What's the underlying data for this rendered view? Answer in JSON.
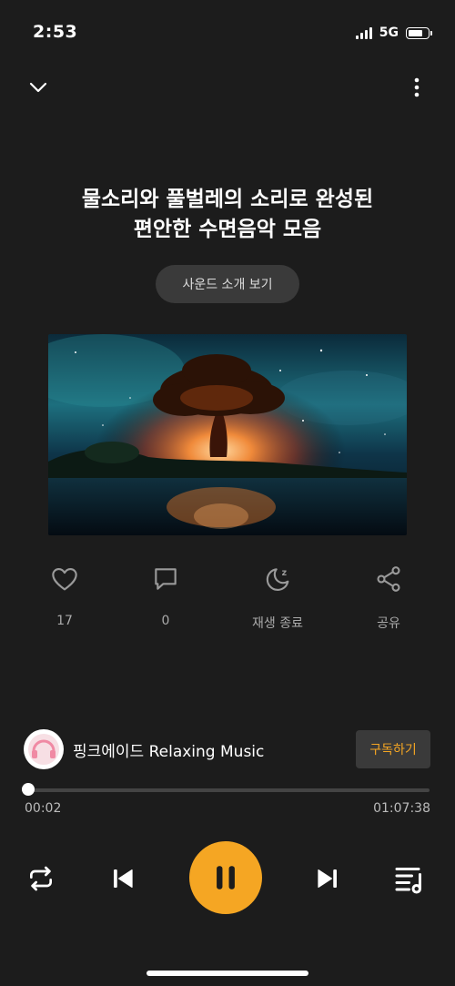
{
  "status_bar": {
    "time": "2:53",
    "network": "5G",
    "battery_level": 0.7
  },
  "header": {
    "collapse_icon": "chevron-down-icon",
    "more_icon": "more-vertical-icon"
  },
  "title_line1": "물소리와 풀벌레의 소리로 완성된",
  "title_line2": "편안한 수면음악 모음",
  "intro_button": "사운드 소개 보기",
  "actions": [
    {
      "icon": "heart-icon",
      "label": "17"
    },
    {
      "icon": "comment-icon",
      "label": "0"
    },
    {
      "icon": "sleep-timer-icon",
      "label": "재생 종료"
    },
    {
      "icon": "share-icon",
      "label": "공유"
    }
  ],
  "artist": {
    "name": "핑크에이드 Relaxing Music",
    "subscribe_label": "구독하기"
  },
  "playback": {
    "current_time": "00:02",
    "total_time": "01:07:38",
    "progress": 0.0005
  },
  "controls": [
    "repeat-icon",
    "previous-icon",
    "pause-icon",
    "next-icon",
    "playlist-icon"
  ],
  "colors": {
    "accent": "#f5a623",
    "background": "#1c1c1c"
  }
}
